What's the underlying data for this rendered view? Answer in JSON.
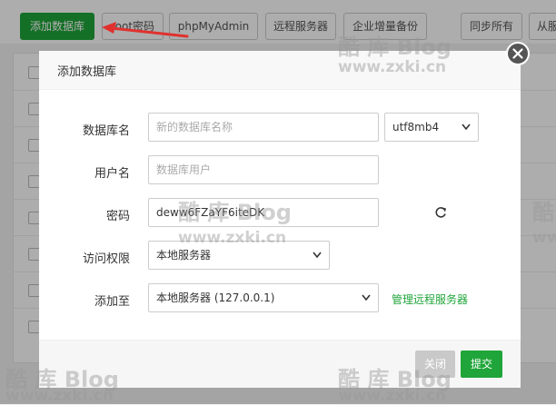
{
  "toolbar": {
    "add_db": "添加数据库",
    "root_pw": "root密码",
    "phpmyadmin": "phpMyAdmin",
    "remote_server": "远程服务器",
    "enterprise_backup": "企业增量备份",
    "sync_all": "同步所有",
    "from_server": "从服"
  },
  "dialog": {
    "title": "添加数据库",
    "fields": {
      "db_name_label": "数据库名",
      "db_name_placeholder": "新的数据库名称",
      "charset_value": "utf8mb4",
      "username_label": "用户名",
      "username_placeholder": "数据库用户",
      "password_label": "密码",
      "password_value": "deww6FZaYF6iteDK",
      "access_label": "访问权限",
      "access_value": "本地服务器",
      "add_to_label": "添加至",
      "add_to_value": "本地服务器 (127.0.0.1)",
      "manage_remote_link": "管理远程服务器"
    },
    "buttons": {
      "cancel": "关闭",
      "submit": "提交"
    }
  },
  "watermark": {
    "logo": "酷 库 Blog",
    "url": "www.zxki.cn"
  },
  "colors": {
    "primary_green": "#20a53a",
    "annotation_red": "#e0312f"
  }
}
